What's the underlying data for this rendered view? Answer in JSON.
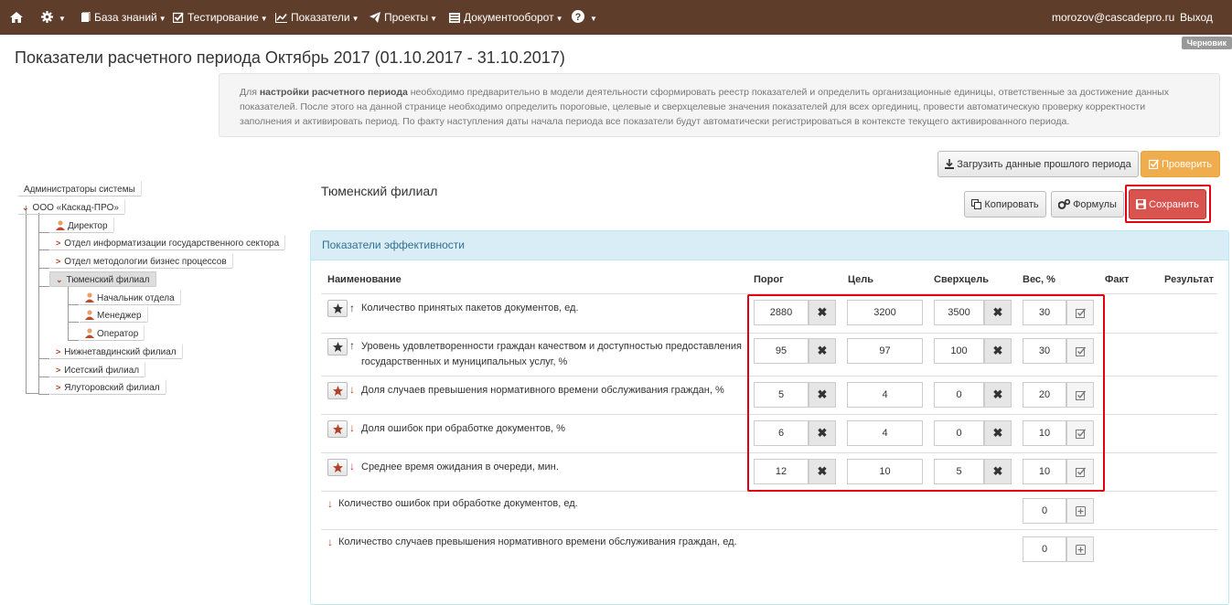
{
  "nav": {
    "knowledge": "База знаний",
    "testing": "Тестирование",
    "metrics": "Показатели",
    "projects": "Проекты",
    "docs": "Документооборот",
    "user": "morozov@cascadepro.ru",
    "logout": "Выход"
  },
  "badge": "Черновик",
  "title": "Показатели расчетного периода Октябрь 2017 (01.10.2017 - 31.10.2017)",
  "info": {
    "p1": "Для ",
    "bold": "настройки расчетного периода",
    "p2": " необходимо предварительно в модели деятельности сформировать реестр показателей и определить организационные единицы, ответственные за достижение данных показателей. После этого на данной странице необходимо определить пороговые, целевые и сверхцелевые значения показателей для всех оргединиц, провести автоматическую проверку корректности заполнения и активировать период. По факту наступления даты начала периода все показатели будут автоматически регистрироваться в контексте текущего активированного периода."
  },
  "buttons": {
    "load_prev": "Загрузить данные прошлого периода",
    "check": "Проверить",
    "copy": "Копировать",
    "formulas": "Формулы",
    "save": "Сохранить"
  },
  "tree": [
    "Администраторы системы",
    "ООО «Каскад-ПРО»",
    "Директор",
    "Отдел информатизации государственного сектора",
    "Отдел методологии бизнес процессов",
    "Тюменский филиал",
    "Начальник отдела",
    "Менеджер",
    "Оператор",
    "Нижнетавдинский филиал",
    "Исетский филиал",
    "Ялуторовский филиал"
  ],
  "branch": "Тюменский филиал",
  "panel_title": "Показатели эффективности",
  "columns": [
    "Наименование",
    "Порог",
    "Цель",
    "Сверхцель",
    "Вес, %",
    "Факт",
    "Результат"
  ],
  "rows": [
    {
      "name": "Количество принятых пакетов документов, ед.",
      "dir": "up",
      "threshold": "2880",
      "target": "3200",
      "super": "3500",
      "weight": "30"
    },
    {
      "name": "Уровень удовлетворенности граждан качеством и доступностью предоставления государственных и муниципальных услуг, %",
      "dir": "up",
      "threshold": "95",
      "target": "97",
      "super": "100",
      "weight": "30"
    },
    {
      "name": "Доля случаев превышения нормативного времени обслуживания граждан, %",
      "dir": "down",
      "threshold": "5",
      "target": "4",
      "super": "0",
      "weight": "20"
    },
    {
      "name": "Доля ошибок при обработке документов, %",
      "dir": "down",
      "threshold": "6",
      "target": "4",
      "super": "0",
      "weight": "10"
    },
    {
      "name": "Среднее время ожидания в очереди, мин.",
      "dir": "down",
      "threshold": "12",
      "target": "10",
      "super": "5",
      "weight": "10"
    }
  ],
  "extra_rows": [
    {
      "name": "Количество ошибок при обработке документов, ед.",
      "weight": "0"
    },
    {
      "name": "Количество случаев превышения нормативного времени обслуживания граждан, ед.",
      "weight": "0"
    }
  ],
  "colors": {
    "navbar": "#5e3d2b",
    "save": "#d9534f",
    "check": "#f0ad4e",
    "panel_head": "#d9edf7",
    "highlight": "#e3000f"
  }
}
